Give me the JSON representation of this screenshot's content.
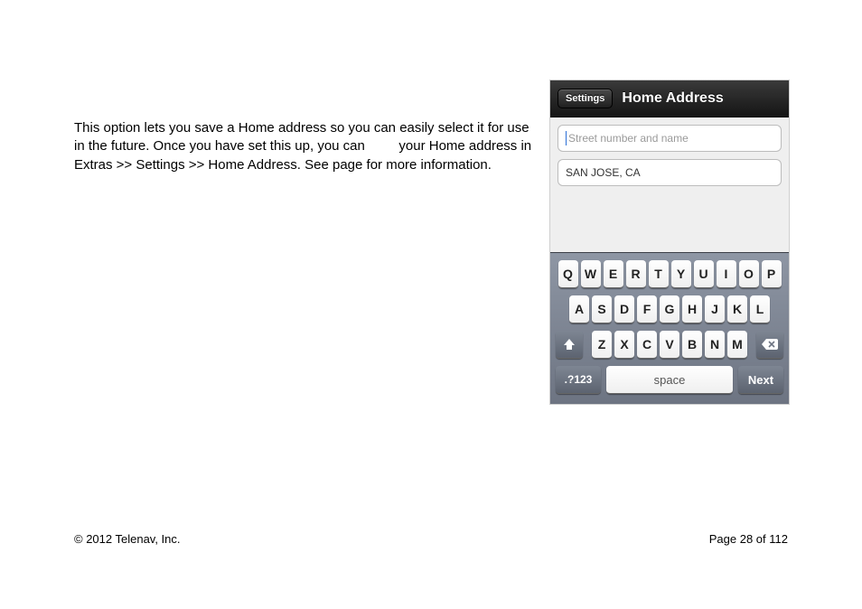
{
  "body": {
    "t1": "This option lets you save a Home address so you can easily select it for use in the future. Once you have set this up, you can ",
    "t2": " your Home address in Extras >> Settings >> Home Address. See page ",
    "link_page": "   ",
    "t3": " for more information."
  },
  "footer": {
    "copyright": "© 2012 Telenav, Inc.",
    "page": "Page 28 of 112"
  },
  "phone": {
    "back": "Settings",
    "title": "Home Address",
    "placeholder": "Street number and name",
    "city": "SAN JOSE, CA"
  },
  "kb": {
    "r1": [
      "Q",
      "W",
      "E",
      "R",
      "T",
      "Y",
      "U",
      "I",
      "O",
      "P"
    ],
    "r2": [
      "A",
      "S",
      "D",
      "F",
      "G",
      "H",
      "J",
      "K",
      "L"
    ],
    "r3": [
      "Z",
      "X",
      "C",
      "V",
      "B",
      "N",
      "M"
    ],
    "mode": ".?123",
    "space": "space",
    "next": "Next"
  }
}
